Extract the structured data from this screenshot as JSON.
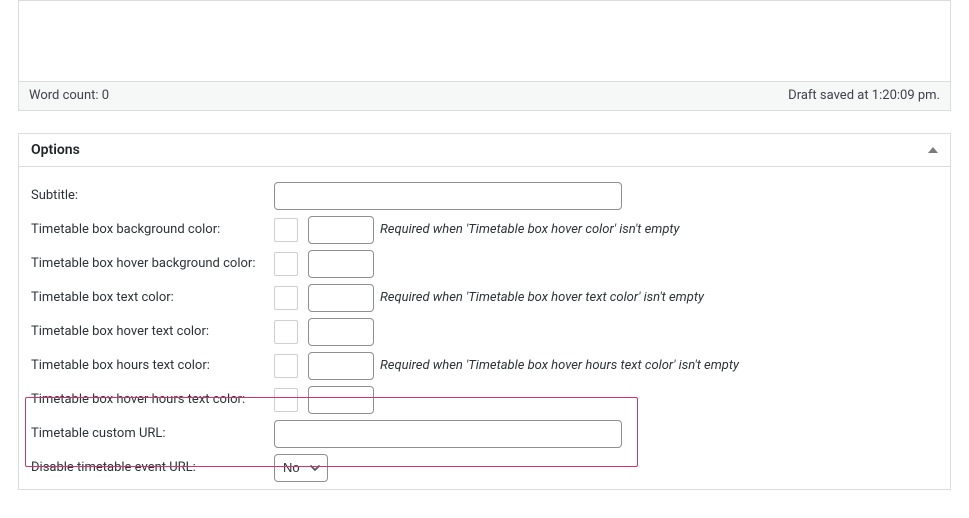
{
  "editor": {
    "word_count_label": "Word count: 0",
    "draft_saved_label": "Draft saved at 1:20:09 pm."
  },
  "options": {
    "title": "Options",
    "subtitle_label": "Subtitle:",
    "bg_color_label": "Timetable box background color:",
    "bg_color_hint": "Required when 'Timetable box hover color' isn't empty",
    "hover_bg_label": "Timetable box hover background color:",
    "text_color_label": "Timetable box text color:",
    "text_color_hint": "Required when 'Timetable box hover text color' isn't empty",
    "hover_text_label": "Timetable box hover text color:",
    "hours_text_label": "Timetable box hours text color:",
    "hours_text_hint": "Required when 'Timetable box hover hours text color' isn't empty",
    "hover_hours_label": "Timetable box hover hours text color:",
    "custom_url_label": "Timetable custom URL:",
    "disable_url_label": "Disable timetable event URL:",
    "disable_url_value": "No"
  }
}
